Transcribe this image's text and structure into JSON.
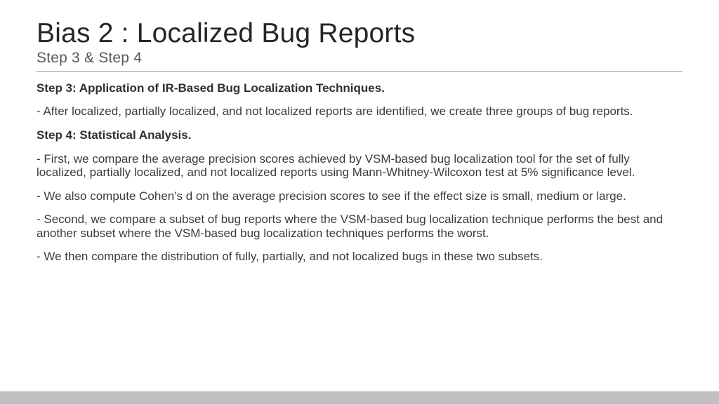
{
  "slide": {
    "title": "Bias 2 : Localized Bug Reports",
    "subtitle": "Step 3 & Step 4",
    "body": {
      "step3_heading": "Step 3: Application of IR-Based Bug Localization Techniques.",
      "step3_p1": "- After localized, partially localized, and not localized reports are identified, we create three groups of bug reports.",
      "step4_heading": "Step 4: Statistical Analysis.",
      "step4_p1": "- First, we compare the average precision scores achieved by VSM-based bug localization tool for the set of fully localized, partially localized, and not localized reports using Mann-Whitney-Wilcoxon test at 5% significance level.",
      "step4_p2": "- We also compute Cohen's d on the average precision scores to see if the effect size is small, medium or large.",
      "step4_p3": "- Second, we compare a subset of bug reports where the VSM-based bug localization technique performs the best and another subset where the VSM-based bug localization techniques performs the worst.",
      "step4_p4": "- We then compare the distribution of fully, partially, and not localized bugs in these two subsets."
    }
  }
}
